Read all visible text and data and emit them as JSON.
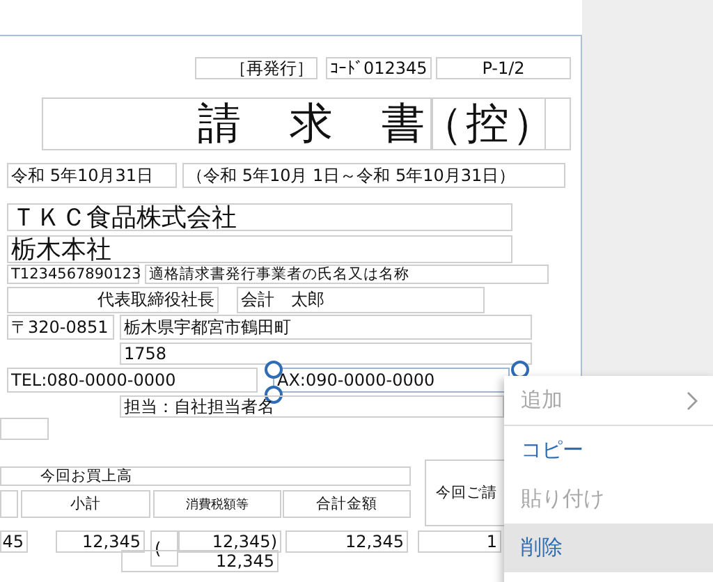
{
  "fields": [
    {
      "text": "［再発行］",
      "kind": "normal",
      "selected": false
    },
    {
      "text": "ｺｰﾄﾞ012345",
      "kind": "normal",
      "selected": false
    },
    {
      "text": "P-1/2",
      "kind": "normal",
      "selected": false
    },
    {
      "text": "請　求　書",
      "kind": "title",
      "selected": false
    },
    {
      "text": "（控）",
      "kind": "title",
      "selected": false
    },
    {
      "text": "令和 5年10月31日",
      "kind": "normal",
      "selected": false
    },
    {
      "text": "（令和 5年10月 1日～令和 5年10月31日）",
      "kind": "normal",
      "selected": false
    },
    {
      "text": "ＴＫＣ食品株式会社",
      "kind": "large",
      "selected": false
    },
    {
      "text": "栃木本社",
      "kind": "large",
      "selected": false
    },
    {
      "text": "T1234567890123",
      "kind": "small",
      "selected": false
    },
    {
      "text": "適格請求書発行事業者の氏名又は名称",
      "kind": "small",
      "selected": false
    },
    {
      "text": "代表取締役社長",
      "kind": "normal",
      "selected": false
    },
    {
      "text": "会計　太郎",
      "kind": "normal",
      "selected": false
    },
    {
      "text": "〒320-0851",
      "kind": "normal",
      "selected": false
    },
    {
      "text": "栃木県宇都宮市鶴田町",
      "kind": "normal",
      "selected": false
    },
    {
      "text": "1758",
      "kind": "normal",
      "selected": false
    },
    {
      "text": "TEL:080-0000-0000",
      "kind": "normal",
      "selected": false
    },
    {
      "text": "AX:090-0000-0000",
      "kind": "normal",
      "selected": true
    },
    {
      "text": "担当：自社担当者名",
      "kind": "normal",
      "selected": false
    },
    {
      "text": "今回お買上高",
      "kind": "small",
      "selected": false
    },
    {
      "text": "小計",
      "kind": "small",
      "selected": false
    },
    {
      "text": "消費税額等",
      "kind": "tiny",
      "selected": false
    },
    {
      "text": "合計金額",
      "kind": "small",
      "selected": false
    },
    {
      "text": "今回ご請",
      "kind": "small",
      "selected": false
    },
    {
      "text": "45",
      "kind": "normal",
      "selected": false
    },
    {
      "text": "12,345",
      "kind": "normal",
      "selected": false
    },
    {
      "text": "(",
      "kind": "normal",
      "selected": false
    },
    {
      "text": "12,345)",
      "kind": "normal",
      "selected": false
    },
    {
      "text": "12,345",
      "kind": "normal",
      "selected": false
    },
    {
      "text": "1",
      "kind": "normal",
      "selected": false
    },
    {
      "text": "12,345",
      "kind": "normal",
      "selected": false
    }
  ],
  "context_menu": [
    {
      "label": "追加",
      "disabled": true,
      "selected": false,
      "submenu": true
    },
    {
      "label": "コピー",
      "disabled": false,
      "selected": false,
      "submenu": false
    },
    {
      "label": "貼り付け",
      "disabled": true,
      "selected": false,
      "submenu": false
    },
    {
      "label": "削除",
      "disabled": false,
      "selected": true,
      "submenu": false
    }
  ]
}
